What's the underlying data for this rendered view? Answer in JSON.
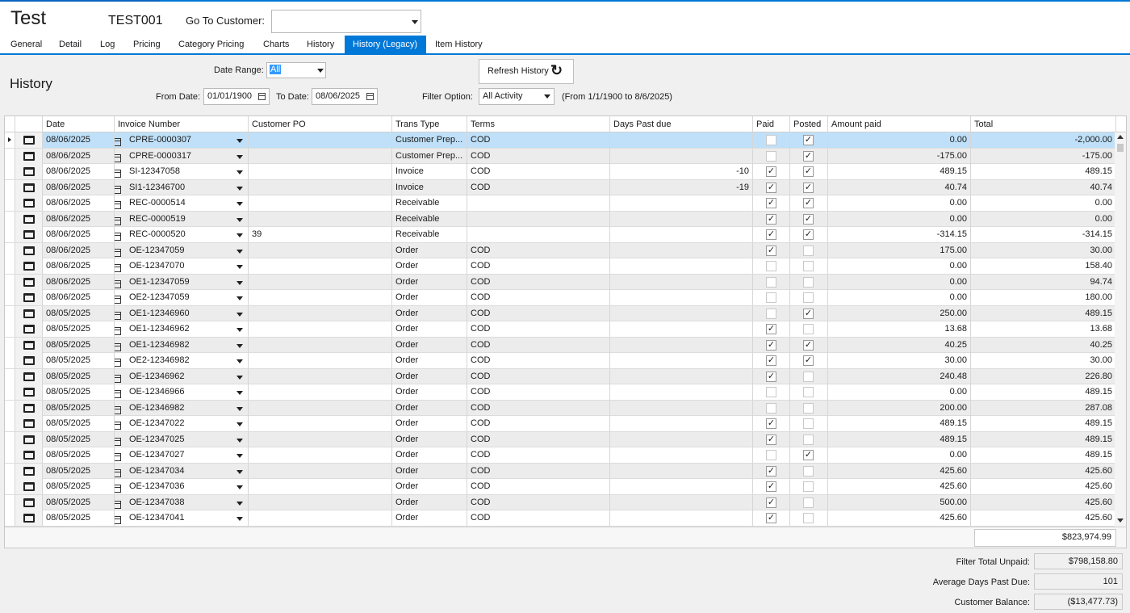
{
  "header": {
    "customer_name": "Test",
    "customer_code": "TEST001",
    "goto_label": "Go To Customer:",
    "goto_value": ""
  },
  "tabs": [
    {
      "label": "General"
    },
    {
      "label": "Detail"
    },
    {
      "label": "Log"
    },
    {
      "label": "Pricing"
    },
    {
      "label": "Category Pricing"
    },
    {
      "label": "Charts"
    },
    {
      "label": "History"
    },
    {
      "label": "History (Legacy)",
      "active": true
    },
    {
      "label": "Item History"
    }
  ],
  "filters": {
    "section_title": "History",
    "date_range_label": "Date Range:",
    "date_range_value": "All",
    "refresh_label": "Refresh History",
    "from_label": "From Date:",
    "from_value": "01/01/1900",
    "to_label": "To Date:",
    "to_value": "08/06/2025",
    "filter_label": "Filter Option:",
    "filter_value": "All Activity",
    "range_note": "(From 1/1/1900 to 8/6/2025)"
  },
  "grid": {
    "columns": [
      "Date",
      "Invoice Number",
      "Customer PO",
      "Trans Type",
      "Terms",
      "Days Past due",
      "Paid",
      "Posted",
      "Amount paid",
      "Total"
    ],
    "rows": [
      {
        "date": "08/06/2025",
        "invoice": "CPRE-0000307",
        "po": "",
        "type": "Customer Prep...",
        "terms": "COD",
        "days": "",
        "paid": false,
        "posted": true,
        "amount": "0.00",
        "total": "-2,000.00",
        "selected": true
      },
      {
        "date": "08/06/2025",
        "invoice": "CPRE-0000317",
        "po": "",
        "type": "Customer Prep...",
        "terms": "COD",
        "days": "",
        "paid": false,
        "posted": true,
        "amount": "-175.00",
        "total": "-175.00"
      },
      {
        "date": "08/06/2025",
        "invoice": "SI-12347058",
        "po": "",
        "type": "Invoice",
        "terms": "COD",
        "days": "-10",
        "paid": true,
        "posted": true,
        "amount": "489.15",
        "total": "489.15"
      },
      {
        "date": "08/06/2025",
        "invoice": "SI1-12346700",
        "po": "",
        "type": "Invoice",
        "terms": "COD",
        "days": "-19",
        "paid": true,
        "posted": true,
        "amount": "40.74",
        "total": "40.74"
      },
      {
        "date": "08/06/2025",
        "invoice": "REC-0000514",
        "po": "",
        "type": "Receivable",
        "terms": "",
        "days": "",
        "paid": true,
        "posted": true,
        "amount": "0.00",
        "total": "0.00"
      },
      {
        "date": "08/06/2025",
        "invoice": "REC-0000519",
        "po": "",
        "type": "Receivable",
        "terms": "",
        "days": "",
        "paid": true,
        "posted": true,
        "amount": "0.00",
        "total": "0.00"
      },
      {
        "date": "08/06/2025",
        "invoice": "REC-0000520",
        "po": "39",
        "type": "Receivable",
        "terms": "",
        "days": "",
        "paid": true,
        "posted": true,
        "amount": "-314.15",
        "total": "-314.15"
      },
      {
        "date": "08/06/2025",
        "invoice": "OE-12347059",
        "po": "",
        "type": "Order",
        "terms": "COD",
        "days": "",
        "paid": true,
        "posted": false,
        "amount": "175.00",
        "total": "30.00"
      },
      {
        "date": "08/06/2025",
        "invoice": "OE-12347070",
        "po": "",
        "type": "Order",
        "terms": "COD",
        "days": "",
        "paid": false,
        "posted": false,
        "amount": "0.00",
        "total": "158.40"
      },
      {
        "date": "08/06/2025",
        "invoice": "OE1-12347059",
        "po": "",
        "type": "Order",
        "terms": "COD",
        "days": "",
        "paid": false,
        "posted": false,
        "amount": "0.00",
        "total": "94.74"
      },
      {
        "date": "08/06/2025",
        "invoice": "OE2-12347059",
        "po": "",
        "type": "Order",
        "terms": "COD",
        "days": "",
        "paid": false,
        "posted": false,
        "amount": "0.00",
        "total": "180.00"
      },
      {
        "date": "08/05/2025",
        "invoice": "OE1-12346960",
        "po": "",
        "type": "Order",
        "terms": "COD",
        "days": "",
        "paid": false,
        "posted": true,
        "amount": "250.00",
        "total": "489.15"
      },
      {
        "date": "08/05/2025",
        "invoice": "OE1-12346962",
        "po": "",
        "type": "Order",
        "terms": "COD",
        "days": "",
        "paid": true,
        "posted": false,
        "amount": "13.68",
        "total": "13.68"
      },
      {
        "date": "08/05/2025",
        "invoice": "OE1-12346982",
        "po": "",
        "type": "Order",
        "terms": "COD",
        "days": "",
        "paid": true,
        "posted": true,
        "amount": "40.25",
        "total": "40.25"
      },
      {
        "date": "08/05/2025",
        "invoice": "OE2-12346982",
        "po": "",
        "type": "Order",
        "terms": "COD",
        "days": "",
        "paid": true,
        "posted": true,
        "amount": "30.00",
        "total": "30.00"
      },
      {
        "date": "08/05/2025",
        "invoice": "OE-12346962",
        "po": "",
        "type": "Order",
        "terms": "COD",
        "days": "",
        "paid": true,
        "posted": false,
        "amount": "240.48",
        "total": "226.80"
      },
      {
        "date": "08/05/2025",
        "invoice": "OE-12346966",
        "po": "",
        "type": "Order",
        "terms": "COD",
        "days": "",
        "paid": false,
        "posted": false,
        "amount": "0.00",
        "total": "489.15"
      },
      {
        "date": "08/05/2025",
        "invoice": "OE-12346982",
        "po": "",
        "type": "Order",
        "terms": "COD",
        "days": "",
        "paid": false,
        "posted": false,
        "amount": "200.00",
        "total": "287.08"
      },
      {
        "date": "08/05/2025",
        "invoice": "OE-12347022",
        "po": "",
        "type": "Order",
        "terms": "COD",
        "days": "",
        "paid": true,
        "posted": false,
        "amount": "489.15",
        "total": "489.15"
      },
      {
        "date": "08/05/2025",
        "invoice": "OE-12347025",
        "po": "",
        "type": "Order",
        "terms": "COD",
        "days": "",
        "paid": true,
        "posted": false,
        "amount": "489.15",
        "total": "489.15"
      },
      {
        "date": "08/05/2025",
        "invoice": "OE-12347027",
        "po": "",
        "type": "Order",
        "terms": "COD",
        "days": "",
        "paid": false,
        "posted": true,
        "amount": "0.00",
        "total": "489.15"
      },
      {
        "date": "08/05/2025",
        "invoice": "OE-12347034",
        "po": "",
        "type": "Order",
        "terms": "COD",
        "days": "",
        "paid": true,
        "posted": false,
        "amount": "425.60",
        "total": "425.60"
      },
      {
        "date": "08/05/2025",
        "invoice": "OE-12347036",
        "po": "",
        "type": "Order",
        "terms": "COD",
        "days": "",
        "paid": true,
        "posted": false,
        "amount": "425.60",
        "total": "425.60"
      },
      {
        "date": "08/05/2025",
        "invoice": "OE-12347038",
        "po": "",
        "type": "Order",
        "terms": "COD",
        "days": "",
        "paid": true,
        "posted": false,
        "amount": "500.00",
        "total": "425.60"
      },
      {
        "date": "08/05/2025",
        "invoice": "OE-12347041",
        "po": "",
        "type": "Order",
        "terms": "COD",
        "days": "",
        "paid": true,
        "posted": false,
        "amount": "425.60",
        "total": "425.60"
      }
    ],
    "grand_total": "$823,974.99"
  },
  "summary": [
    {
      "label": "Filter Total Unpaid:",
      "value": "$798,158.80"
    },
    {
      "label": "Average Days Past Due:",
      "value": "101"
    },
    {
      "label": "Customer Balance:",
      "value": "($13,477.73)"
    }
  ],
  "colors": {
    "accent": "#0078d7",
    "selected_row": "#bfe0f8",
    "alt_row": "#ececec"
  }
}
